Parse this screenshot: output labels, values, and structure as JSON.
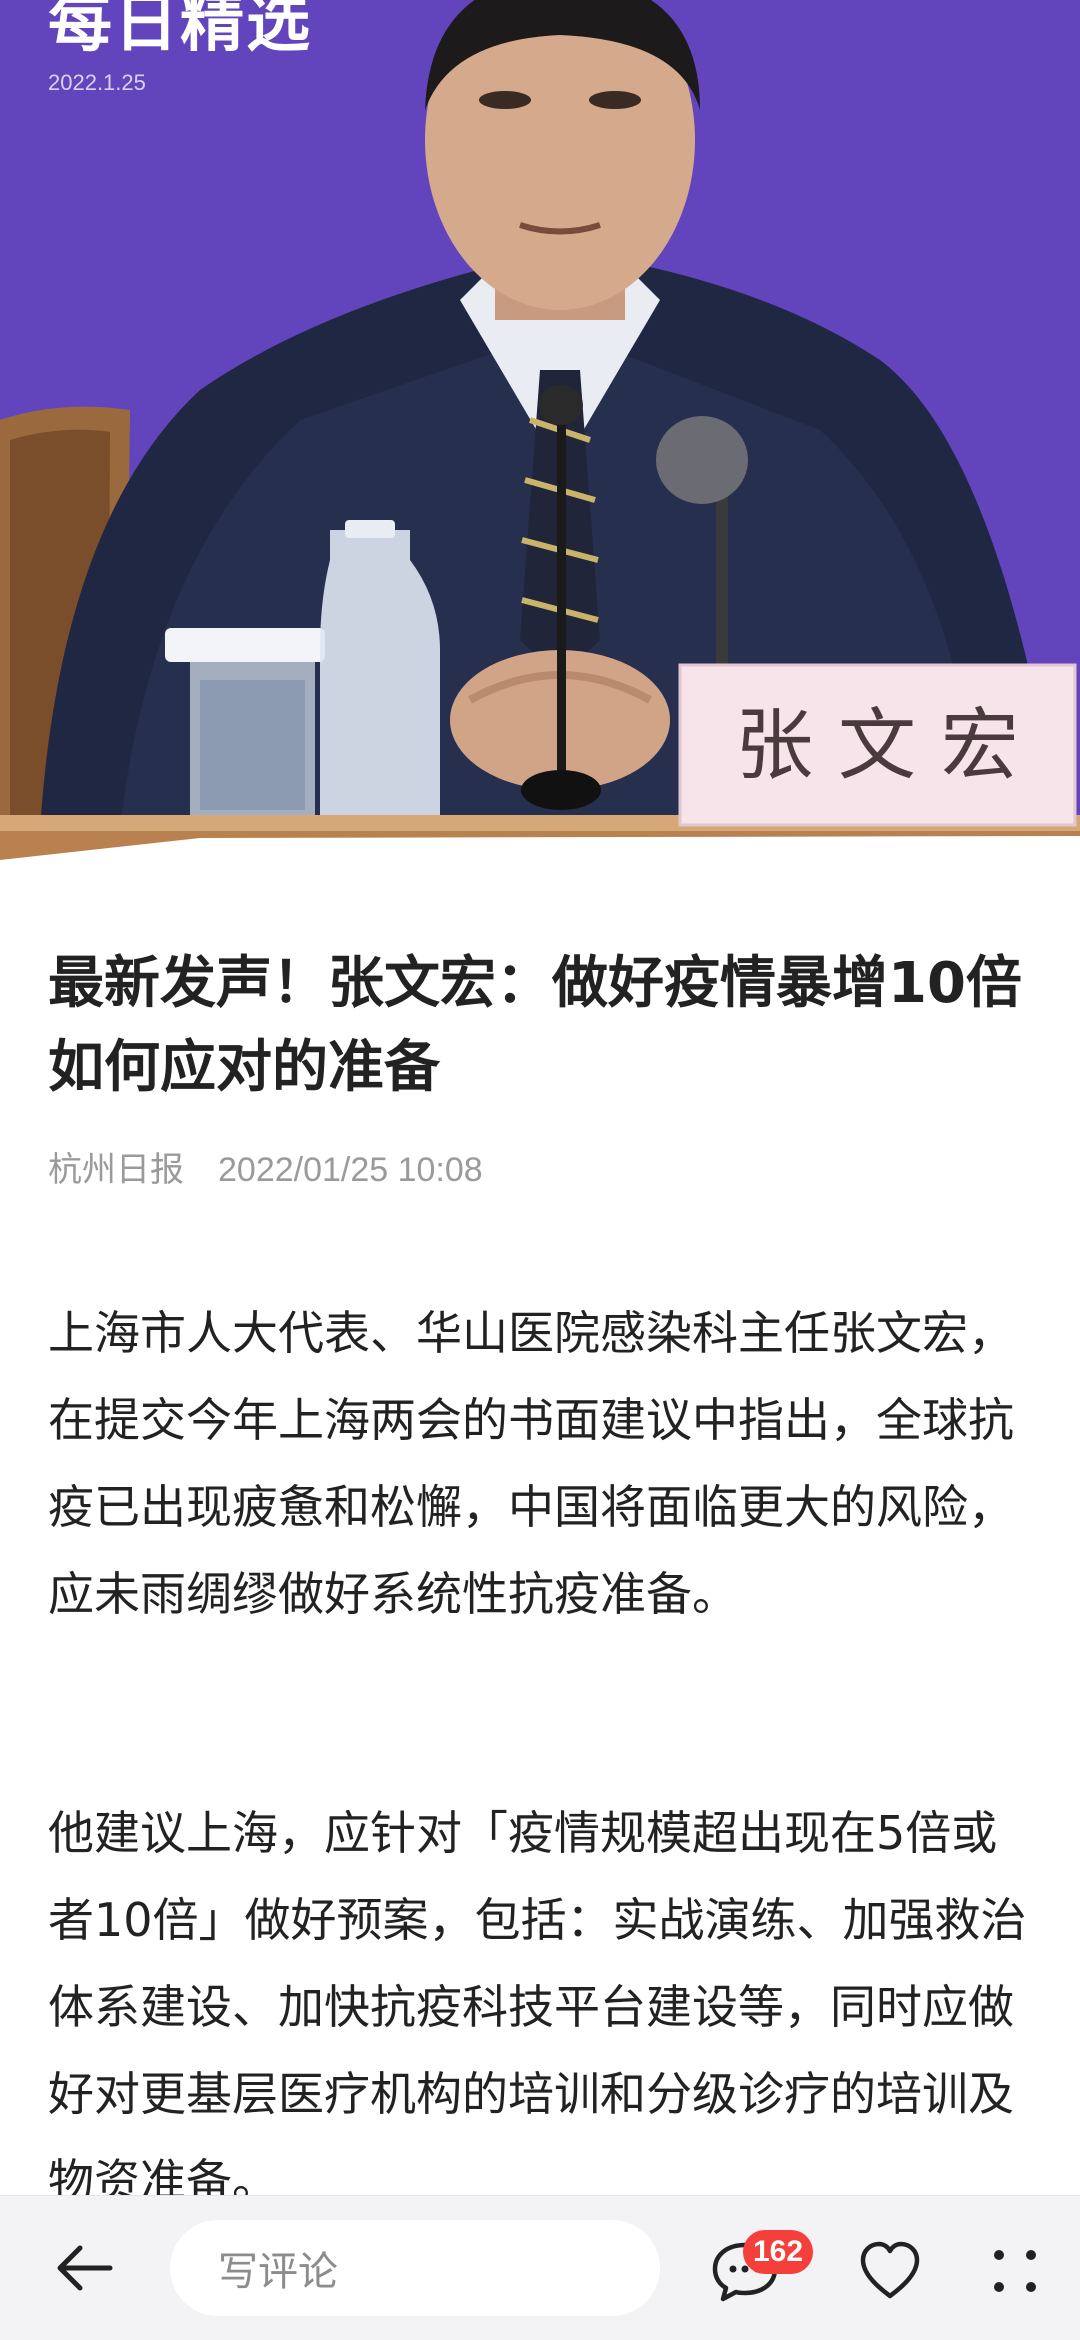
{
  "hero": {
    "title_fragment": "每日精选",
    "date": "2022.1.25",
    "nameplate": "张 文 宏"
  },
  "article": {
    "headline": "最新发声！张文宏：做好疫情暴增10倍如何应对的准备",
    "source": "杭州日报",
    "datetime": "2022/01/25 10:08",
    "paragraphs": [
      "上海市人大代表、华山医院感染科主任张文宏，在提交今年上海两会的书面建议中指出，全球抗疫已出现疲惫和松懈，中国将面临更大的风险，应未雨绸缪做好系统性抗疫准备。",
      "他建议上海，应针对「疫情规模超出现在5倍或者10倍」做好预案，包括：实战演练、加强救治体系建设、加快抗疫科技平台建设等，同时应做好对更基层医疗机构的培训和分级诊疗的培训及物资准备。"
    ]
  },
  "bottom_bar": {
    "comment_placeholder": "写评论",
    "comment_count": "162",
    "icons": {
      "back": "arrow-left-icon",
      "comment": "comment-bubble-icon",
      "like": "heart-icon",
      "more": "more-dots-icon"
    }
  },
  "colors": {
    "hero_background": "#6446bf",
    "badge": "#f43f3b",
    "text_primary": "#222222",
    "text_meta": "#9a9a9a",
    "bar_background": "#f3f3f5"
  }
}
